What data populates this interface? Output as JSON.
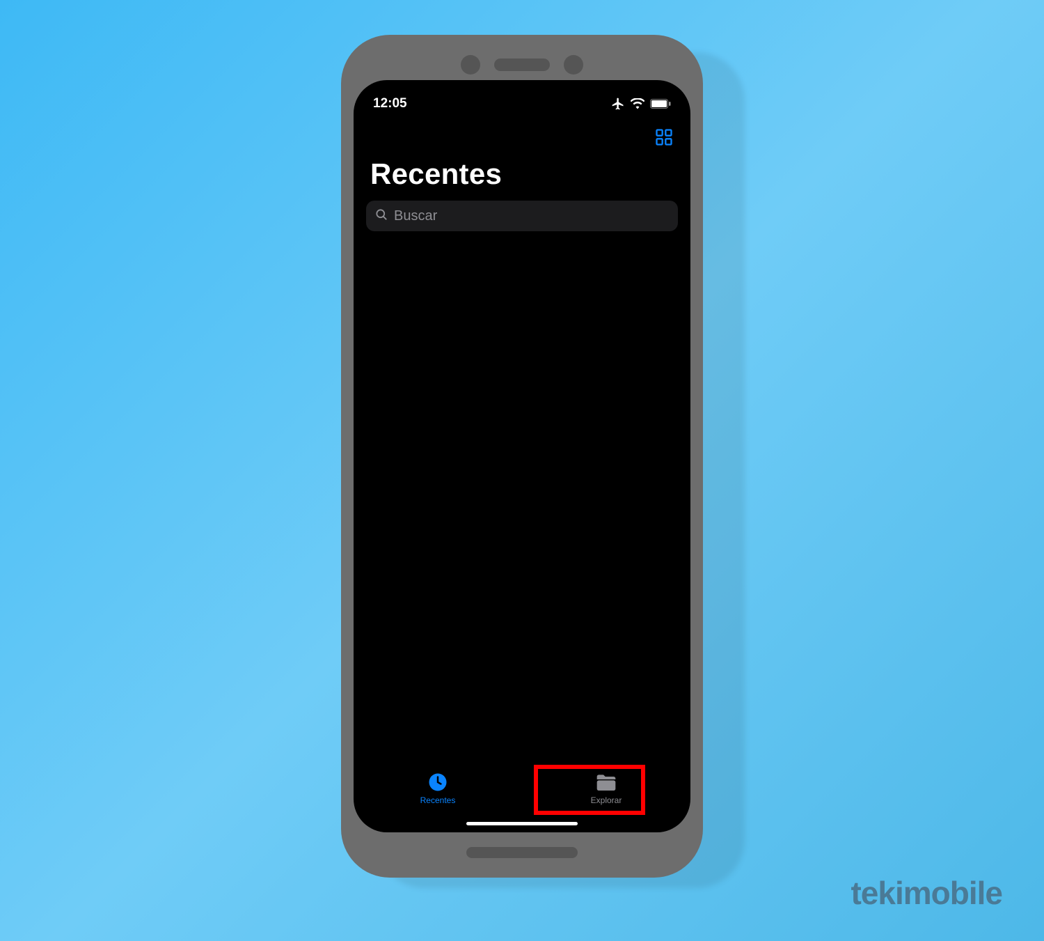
{
  "status": {
    "time": "12:05"
  },
  "header": {
    "title": "Recentes"
  },
  "search": {
    "placeholder": "Buscar"
  },
  "tabs": {
    "recents": {
      "label": "Recentes"
    },
    "browse": {
      "label": "Explorar"
    }
  },
  "watermark": "tekimobile",
  "colors": {
    "accent": "#0a84ff",
    "highlight": "#ff0000"
  }
}
